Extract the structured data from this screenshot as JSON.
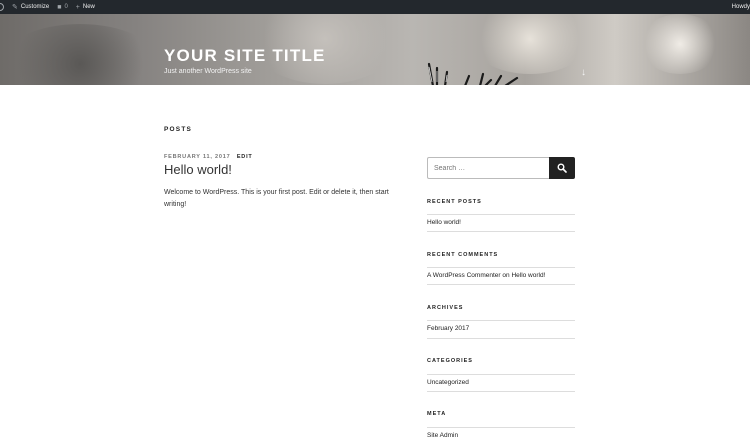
{
  "adminbar": {
    "customize": "Customize",
    "comments_count": "0",
    "new": "New",
    "howdy": "Howdy"
  },
  "header": {
    "site_title": "YOUR SITE TITLE",
    "site_description": "Just another WordPress site",
    "scroll_icon": "arrow-down-icon"
  },
  "content": {
    "section_title": "POSTS",
    "post": {
      "date": "FEBRUARY 11, 2017",
      "edit": "EDIT",
      "title": "Hello world!",
      "body": "Welcome to WordPress. This is your first post. Edit or delete it, then start writing!"
    }
  },
  "sidebar": {
    "search": {
      "placeholder": "Search …",
      "button_icon": "search-icon"
    },
    "recent_posts": {
      "title": "RECENT POSTS",
      "items": [
        "Hello world!"
      ]
    },
    "recent_comments": {
      "title": "RECENT COMMENTS",
      "author": "A WordPress Commenter",
      "on": "on",
      "post": "Hello world!"
    },
    "archives": {
      "title": "ARCHIVES",
      "items": [
        "February 2017"
      ]
    },
    "categories": {
      "title": "CATEGORIES",
      "items": [
        "Uncategorized"
      ]
    },
    "meta": {
      "title": "META",
      "items": [
        "Site Admin"
      ]
    }
  }
}
